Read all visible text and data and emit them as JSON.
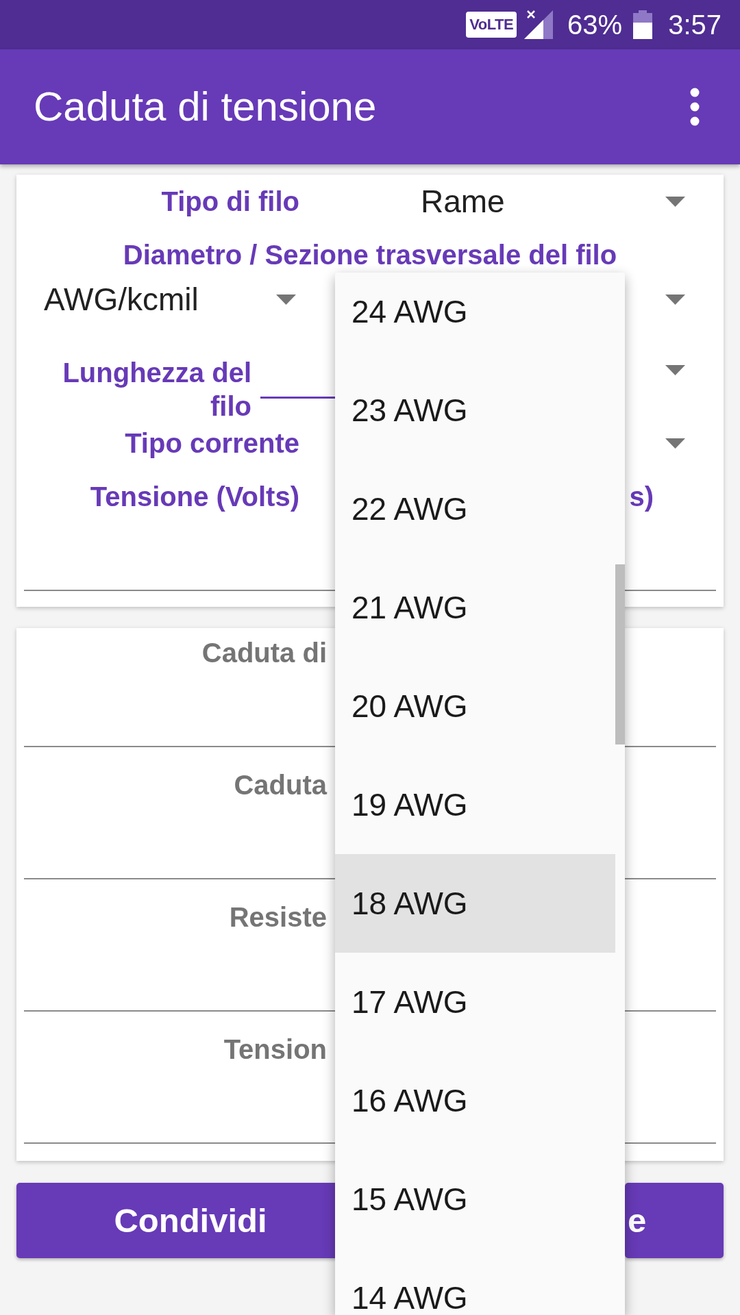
{
  "status_bar": {
    "network_badge": "VoLTE",
    "battery": "63%",
    "time": "3:57"
  },
  "app_bar": {
    "title": "Caduta di tensione"
  },
  "inputs_card": {
    "wire_type": {
      "label": "Tipo di filo",
      "value": "Rame"
    },
    "cross_section": {
      "label": "Diametro / Sezione trasversale del filo",
      "unit": "AWG/kcmil"
    },
    "length": {
      "label": "Lunghezza del filo",
      "focused": true
    },
    "current_type": {
      "label": "Tipo corrente"
    },
    "voltage": {
      "label": "Tensione (Volts)"
    },
    "column_2_label": "s)"
  },
  "results_card": {
    "rows": [
      {
        "label": "Caduta di"
      },
      {
        "label": "Caduta"
      },
      {
        "label": "Resiste"
      },
      {
        "label": "Tension"
      }
    ]
  },
  "buttons": [
    {
      "label": "Condividi"
    },
    {
      "label": "e"
    }
  ],
  "dropdown": {
    "items": [
      {
        "label": "24 AWG",
        "selected": false
      },
      {
        "label": "23 AWG",
        "selected": false
      },
      {
        "label": "22 AWG",
        "selected": false
      },
      {
        "label": "21 AWG",
        "selected": false
      },
      {
        "label": "20 AWG",
        "selected": false
      },
      {
        "label": "19 AWG",
        "selected": false
      },
      {
        "label": "18 AWG",
        "selected": true
      },
      {
        "label": "17 AWG",
        "selected": false
      },
      {
        "label": "16 AWG",
        "selected": false
      },
      {
        "label": "15 AWG",
        "selected": false
      },
      {
        "label": "14 AWG",
        "selected": false
      }
    ]
  }
}
